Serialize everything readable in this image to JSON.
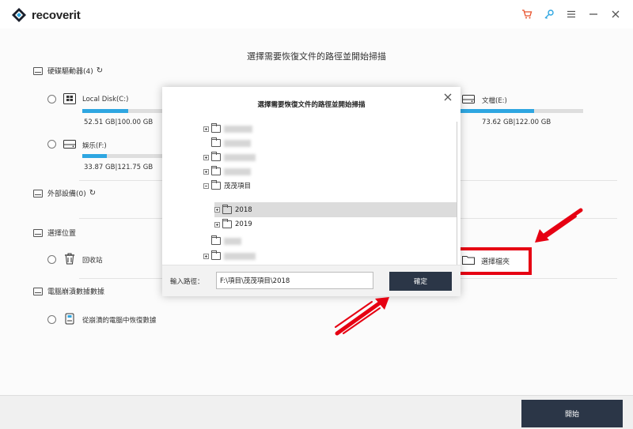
{
  "app": {
    "name": "recoverit"
  },
  "main": {
    "title": "選擇需要恢復文件的路徑並開始掃描"
  },
  "sections": {
    "hard_drives": "硬碟驅動器(4)",
    "external": "外部設備(0)",
    "location": "選擇位置",
    "crashed": "電腦崩潰數據數據"
  },
  "drives": [
    {
      "label": "Local Disk(C:)",
      "size": "52.51 GB|100.00 GB",
      "used_fraction": 0.525
    },
    {
      "label": "娛乐(F:)",
      "size": "33.87 GB|121.75 GB",
      "used_fraction": 0.278
    },
    {
      "label": "文檔(E:)",
      "size": "73.62 GB|122.00 GB",
      "used_fraction": 0.603
    }
  ],
  "locations": {
    "recycle_bin": "回收站",
    "select_folder": "選擇檔夾",
    "crashed_option": "從崩潰的電腦中恢復數據"
  },
  "dialog": {
    "title": "選擇需要恢復文件的路徑並開始掃描",
    "tree": [
      {
        "label": "",
        "expandable": true,
        "blurred": true
      },
      {
        "label": "",
        "expandable": false,
        "blurred": true
      },
      {
        "label": "",
        "expandable": true,
        "blurred": true
      },
      {
        "label": "",
        "expandable": true,
        "blurred": true
      },
      {
        "label": "茂茂項目",
        "expandable": true,
        "expanded": true
      },
      {
        "label": "2018",
        "expandable": true,
        "selected": true
      },
      {
        "label": "2019",
        "expandable": true
      },
      {
        "label": "",
        "expandable": false,
        "blurred": true
      },
      {
        "label": "",
        "expandable": true,
        "blurred": true
      }
    ],
    "path_label": "輸入路徑：",
    "path_value": "F:\\項目\\茂茂項目\\2018",
    "ok_label": "確定"
  },
  "footer": {
    "start_label": "開始"
  },
  "colors": {
    "accent": "#2ea6e1",
    "dark_button": "#2b3647",
    "highlight_red": "#e60012"
  }
}
